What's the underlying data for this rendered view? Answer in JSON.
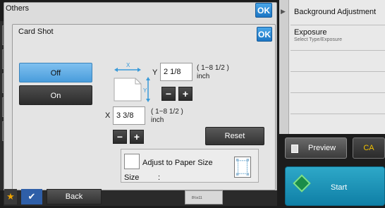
{
  "others_panel": {
    "title": "Others",
    "ok_label": "OK"
  },
  "right_menu": {
    "items": [
      {
        "label": "Background Adjustment",
        "sub": ""
      },
      {
        "label": "Exposure",
        "sub": "Select Type/Exposure"
      }
    ]
  },
  "preview": {
    "label": "Preview"
  },
  "ca": {
    "label": "CA"
  },
  "start": {
    "label": "Start"
  },
  "dialog": {
    "title": "Card Shot",
    "ok_label": "OK",
    "off_label": "Off",
    "on_label": "On",
    "y": {
      "axis": "Y",
      "value": "2 1/8",
      "range": "( 1~8 1/2 )",
      "unit": "inch"
    },
    "x": {
      "axis": "X",
      "value": "3 3/8",
      "range": "( 1~8 1/2 )",
      "unit": "inch"
    },
    "minus": "−",
    "plus": "+",
    "diagram_x": "X",
    "diagram_y": "Y",
    "reset_label": "Reset",
    "adjust_label": "Adjust to Paper Size",
    "size_label": "Size",
    "size_colon": ":"
  },
  "bottom": {
    "star": "★",
    "check": "✔",
    "back_label": "Back",
    "tray_text": "8½x11"
  }
}
